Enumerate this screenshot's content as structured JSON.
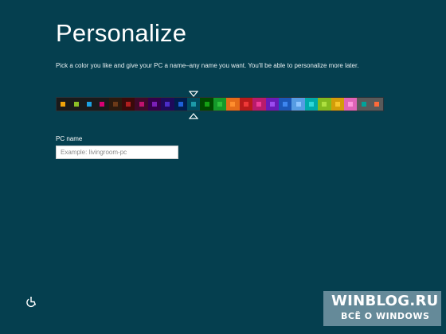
{
  "header": {
    "title": "Personalize",
    "subtitle": "Pick a color you like and give your PC a name–any name you want. You'll be able to personalize more later."
  },
  "color_picker": {
    "selected_index": 10,
    "swatches": [
      {
        "bg": "#1a1a1a",
        "chip": "#f0a30a"
      },
      {
        "bg": "#1a1a1a",
        "chip": "#8cbf26"
      },
      {
        "bg": "#1a1a1a",
        "chip": "#1ba1e2"
      },
      {
        "bg": "#1a1a1a",
        "chip": "#d80073"
      },
      {
        "bg": "#2b1a0e",
        "chip": "#6b3a18"
      },
      {
        "bg": "#3a0a0a",
        "chip": "#b01e1e"
      },
      {
        "bg": "#3f0a2a",
        "chip": "#c0126f"
      },
      {
        "bg": "#33004a",
        "chip": "#7a1fb8"
      },
      {
        "bg": "#1e0a5a",
        "chip": "#4b2cc8"
      },
      {
        "bg": "#001e4e",
        "chip": "#1e60d8"
      },
      {
        "bg": "#004d60",
        "chip": "#1c9aa8"
      },
      {
        "bg": "#004a00",
        "chip": "#14a014"
      },
      {
        "bg": "#15992a",
        "chip": "#2fc13d"
      },
      {
        "bg": "#e56c19",
        "chip": "#ff8e2e"
      },
      {
        "bg": "#b81b1b",
        "chip": "#ef3838"
      },
      {
        "bg": "#b81b6c",
        "chip": "#ef3c98"
      },
      {
        "bg": "#691bb8",
        "chip": "#9a4cf0"
      },
      {
        "bg": "#1b58b8",
        "chip": "#3d86ef"
      },
      {
        "bg": "#569ce3",
        "chip": "#8cc4ff"
      },
      {
        "bg": "#00aaaa",
        "chip": "#2fd8d8"
      },
      {
        "bg": "#83ba1f",
        "chip": "#aee040"
      },
      {
        "bg": "#d39d09",
        "chip": "#f7c52a"
      },
      {
        "bg": "#e064b7",
        "chip": "#ff96dc"
      },
      {
        "bg": "#5a5a5a",
        "chip": "#00a39a"
      },
      {
        "bg": "#5a5a5a",
        "chip": "#ff6a3a"
      }
    ]
  },
  "pc_name": {
    "label": "PC name",
    "placeholder": "Example: livingroom-pc",
    "value": ""
  },
  "watermark": {
    "main": "WINBLOG.RU",
    "sub": "ВСЁ О WINDOWS"
  }
}
